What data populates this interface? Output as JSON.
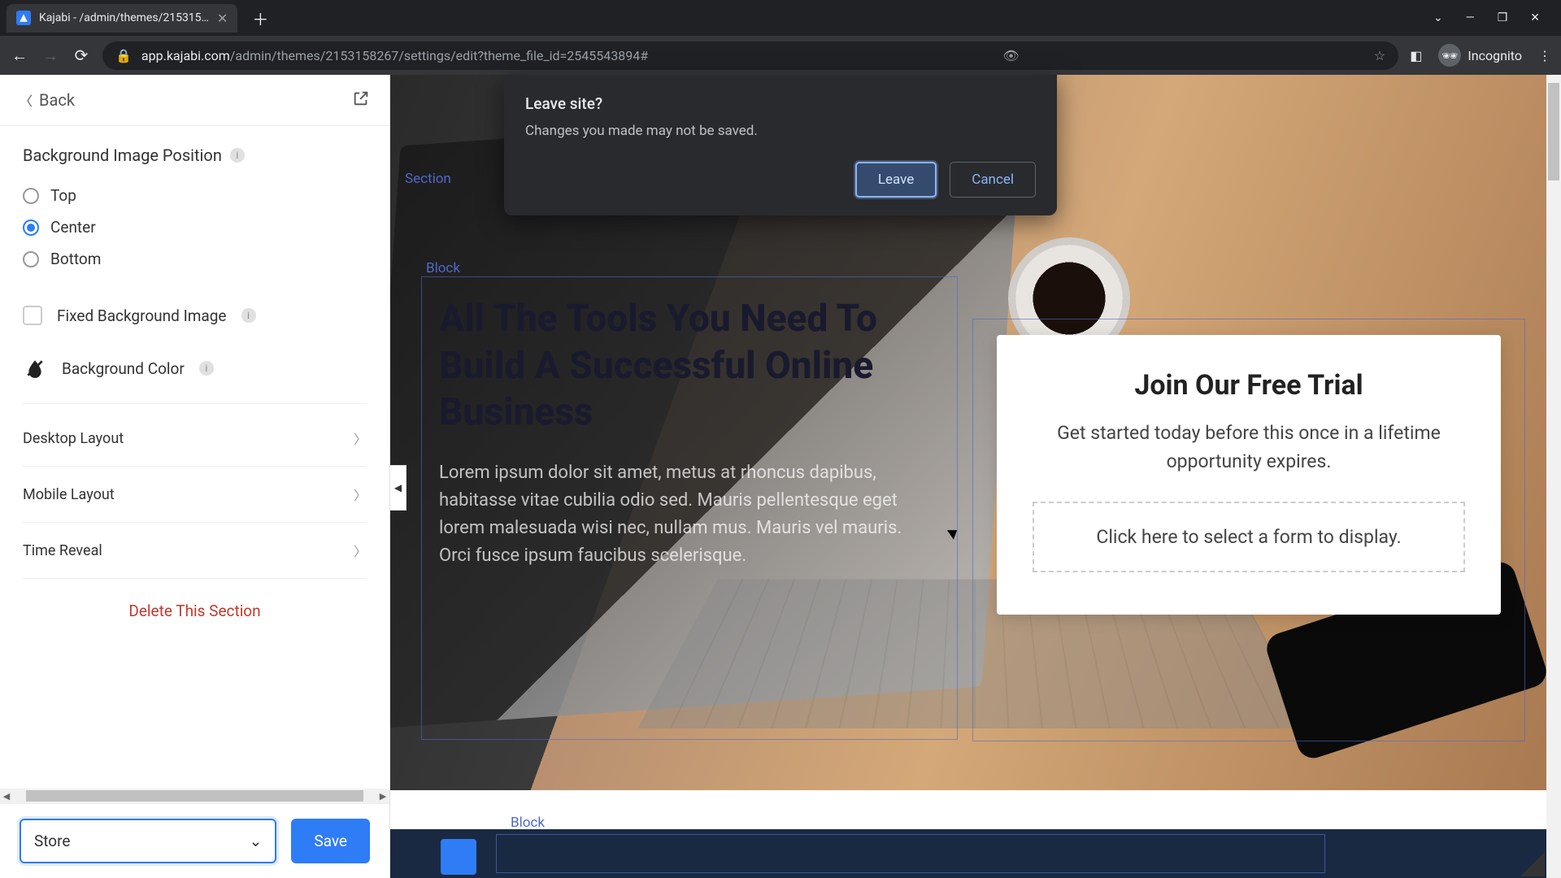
{
  "browser": {
    "tab_title": "Kajabi - /admin/themes/215315…",
    "url_domain": "app.kajabi.com",
    "url_path": "/admin/themes/2153158267/settings/edit?theme_file_id=2545543894#",
    "incognito_label": "Incognito"
  },
  "dialog": {
    "title": "Leave site?",
    "message": "Changes you made may not be saved.",
    "leave": "Leave",
    "cancel": "Cancel"
  },
  "sidebar": {
    "back": "Back",
    "section_title": "Background Image Position",
    "radios": {
      "top": "Top",
      "center": "Center",
      "bottom": "Bottom"
    },
    "fixed_bg": "Fixed Background Image",
    "bg_color": "Background Color",
    "rows": {
      "desktop": "Desktop Layout",
      "mobile": "Mobile Layout",
      "time": "Time Reveal"
    },
    "delete": "Delete This Section",
    "select_value": "Store",
    "save": "Save"
  },
  "preview": {
    "section_tag": "Section",
    "block_tag": "Block",
    "heading": "All The Tools You Need To Build A Successful Online Business",
    "body": "Lorem ipsum dolor sit amet, metus at rhoncus dapibus, habitasse vitae cubilia odio sed. Mauris pellentesque eget lorem malesuada wisi nec, nullam mus. Mauris vel mauris. Orci fusce ipsum faucibus scelerisque.",
    "card_title": "Join Our Free Trial",
    "card_body": "Get started today before this once in a lifetime opportunity expires.",
    "card_placeholder": "Click here to select a form to display."
  }
}
